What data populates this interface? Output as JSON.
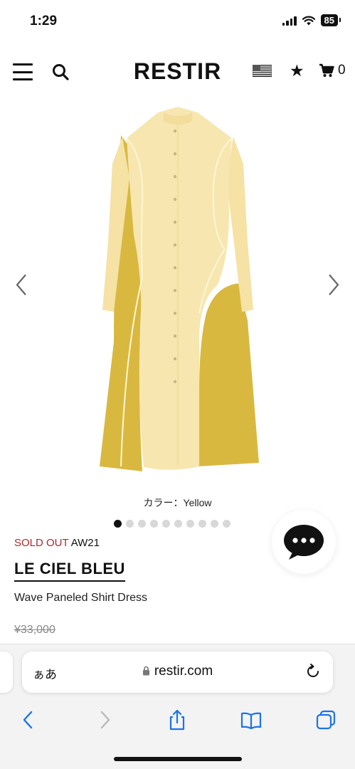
{
  "status": {
    "time": "1:29",
    "battery": "85"
  },
  "header": {
    "logo": "RESTIR",
    "cart_count": "0"
  },
  "gallery": {
    "color_caption": "カラー：Yellow",
    "dot_count": 10,
    "active_dot": 0,
    "colors": {
      "light": "#f7e6b0",
      "dark": "#d9b840",
      "piping": "#fff3cc"
    }
  },
  "product": {
    "status": "SOLD OUT",
    "season": "AW21",
    "brand": "LE CIEL BLEU",
    "name": "Wave Paneled Shirt Dress",
    "price": "¥33,000"
  },
  "browser": {
    "aa_label": "ぁあ",
    "url": "restir.com"
  },
  "colors": {
    "soldout": "#b3262b",
    "text": "#111111",
    "safari_bg": "#f3f3f3",
    "safari_accent": "#1a73e8"
  }
}
